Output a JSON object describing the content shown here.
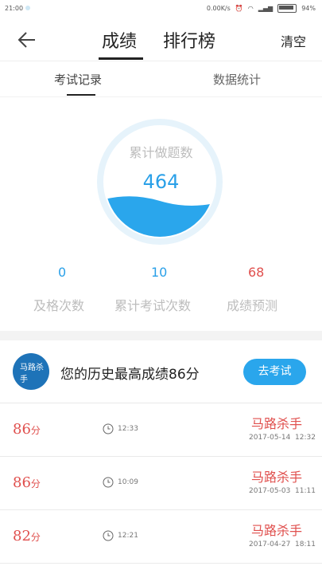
{
  "status": {
    "time": "21:00",
    "right_text": "0.00K/s",
    "battery": "94%"
  },
  "header": {
    "tab_active": "成绩",
    "tab_other": "排行榜",
    "clear": "清空"
  },
  "subtabs": {
    "records": "考试记录",
    "stats": "数据统计"
  },
  "gauge": {
    "title": "累计做题数",
    "value": "464"
  },
  "stats": [
    {
      "value": "0",
      "label": "及格次数"
    },
    {
      "value": "10",
      "label": "累计考试次数"
    },
    {
      "value": "68",
      "label": "成绩预测"
    }
  ],
  "best": {
    "text": "您的历史最高成绩86分",
    "button": "去考试",
    "avatar_text": "马路杀手"
  },
  "records": [
    {
      "score": "86",
      "unit": "分",
      "duration": "12:33",
      "title": "马路杀手",
      "date": "2017-05-14",
      "time": "12:32"
    },
    {
      "score": "86",
      "unit": "分",
      "duration": "10:09",
      "title": "马路杀手",
      "date": "2017-05-03",
      "time": "11:11"
    },
    {
      "score": "82",
      "unit": "分",
      "duration": "12:21",
      "title": "马路杀手",
      "date": "2017-04-27",
      "time": "18:11"
    }
  ]
}
